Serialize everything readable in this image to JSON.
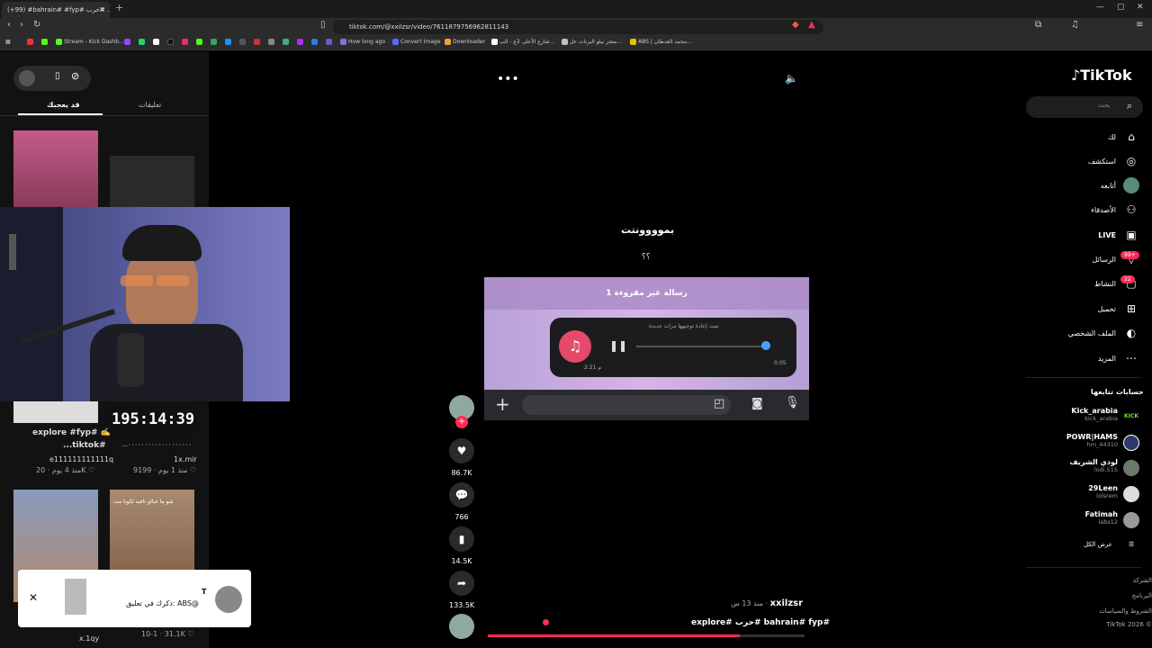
{
  "browser": {
    "tab_title": "(+99) #bahrain# #fyp# حرب# ...",
    "url": "tiktok.com/@xxilzsr/video/7611879756962811143",
    "bookmarks": [
      "Stream - Kick Dashb...",
      "How long ago",
      "Convert Image",
      "Downloader",
      "شارع الأعلى 2ع - الب...",
      "متجر نيلو البرنات عل...",
      "ABS | محمد العدطان..."
    ]
  },
  "left_panel": {
    "tab_liked": "قد يعجبك",
    "tab_comments": "تعليقات",
    "grid": [
      {
        "title": "explore #fyp# ✍️",
        "subtitle": "...tiktok#",
        "user": "e111111111111q",
        "likes": "20K",
        "age": "منذ 4 يوم"
      },
      {
        "title": "195:14:39",
        "subtitle": "...٠٠٠٠٠٠٠٠٠٠٠٠٠٠٠٠٠٠٠",
        "user": "1x.mir",
        "likes": "9199",
        "age": "منذ 1 يوم"
      },
      {
        "user": "x.1qy",
        "likes": "31.1K",
        "age": "10-1"
      }
    ],
    "thumb_caption": "شو ما غبالو تافيه لكونا مت"
  },
  "notification": {
    "name": "T",
    "text": "ذكرك في تعليق: ABS@",
    "close": "✕"
  },
  "video": {
    "caption_top": "بموووونتت",
    "caption_sub": "؟؟",
    "unread": "1 رسالة غير مقروءة",
    "forwarded": "تمت إعادة توجيهها مرات عديدة",
    "time_a": "2:21 م",
    "time_b": "0:05",
    "author": "xxilzsr",
    "age": "منذ 13 س",
    "hashtags": "explore# حرب# bahrain# fyp#",
    "likes": "86.7K",
    "comments": "766",
    "saves": "14.5K",
    "shares": "133.5K"
  },
  "sidebar": {
    "logo": "TikTok",
    "search_placeholder": "بحث",
    "nav": [
      {
        "label": "لك",
        "icon": "home-icon"
      },
      {
        "label": "استكشف",
        "icon": "compass-icon"
      },
      {
        "label": "أتابعه",
        "icon": "following-avatar-icon"
      },
      {
        "label": "الأصدقاء",
        "icon": "friends-icon"
      },
      {
        "label": "LIVE",
        "icon": "live-icon"
      },
      {
        "label": "الرسائل",
        "icon": "messages-icon",
        "badge": "99+"
      },
      {
        "label": "النشاط",
        "icon": "activity-icon",
        "badge": "22"
      },
      {
        "label": "تحميل",
        "icon": "upload-icon"
      },
      {
        "label": "الملف الشخصي",
        "icon": "profile-icon"
      },
      {
        "label": "المزيد",
        "icon": "more-icon"
      }
    ],
    "following_title": "حسابات تتابعها",
    "accounts": [
      {
        "name": "Kick_arabia",
        "user": "kick_arabia"
      },
      {
        "name": "POWR|HAMS",
        "user": "hm_44310"
      },
      {
        "name": "لودي الشريف",
        "user": "lodi.515"
      },
      {
        "name": "29Leen",
        "user": "lolsrem"
      },
      {
        "name": "Fatimah",
        "user": "iabs12"
      }
    ],
    "show_all": "عرض الكل",
    "footer": [
      "الشركة",
      "البرنامج",
      "الشروط والسياسات",
      "TikTok 2026 ©"
    ]
  },
  "colors": {
    "accent": "#fe2c55",
    "progress": "#fe2c55"
  }
}
